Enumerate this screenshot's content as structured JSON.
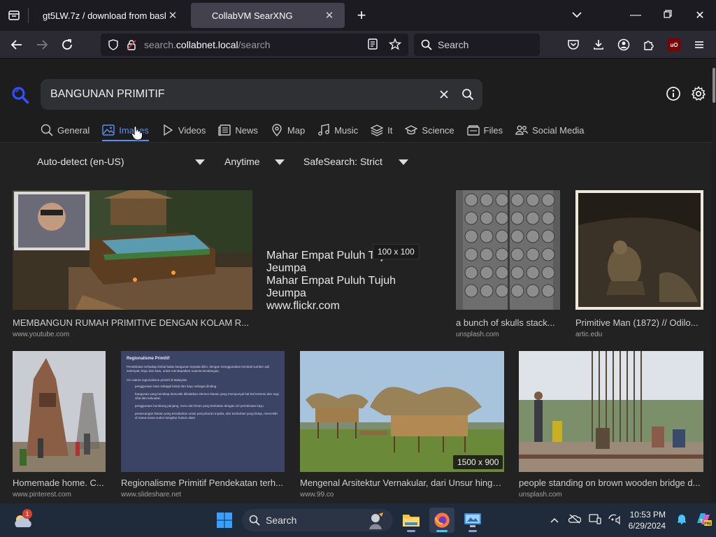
{
  "browser": {
    "tabs": [
      {
        "title": "gt5LW.7z / download from bashupl",
        "active": false
      },
      {
        "title": "CollabVM SearXNG",
        "active": true
      }
    ],
    "url": {
      "prefix": "search.",
      "host": "collabnet.local",
      "path": "/search"
    },
    "search_placeholder": "Search"
  },
  "search": {
    "query": "BANGUNAN PRIMITIF",
    "categories": [
      {
        "label": "General",
        "icon": "search-icon"
      },
      {
        "label": "Images",
        "icon": "image-icon",
        "active": true
      },
      {
        "label": "Videos",
        "icon": "play-icon"
      },
      {
        "label": "News",
        "icon": "newspaper-icon"
      },
      {
        "label": "Map",
        "icon": "map-pin-icon"
      },
      {
        "label": "Music",
        "icon": "music-icon"
      },
      {
        "label": "It",
        "icon": "layers-icon"
      },
      {
        "label": "Science",
        "icon": "graduation-cap-icon"
      },
      {
        "label": "Files",
        "icon": "files-icon"
      },
      {
        "label": "Social Media",
        "icon": "users-icon"
      }
    ],
    "filters": {
      "language": "Auto-detect (en-US)",
      "time": "Anytime",
      "safesearch": "SafeSearch: Strict"
    }
  },
  "results": [
    {
      "title": "MEMBANGUN RUMAH PRIMITIVE DENGAN KOLAM R...",
      "source": "www.youtube.com"
    },
    {
      "title": "a bunch of skulls stack...",
      "source": "unsplash.com"
    },
    {
      "title": "Primitive Man (1872) // Odilo...",
      "source": "artic.edu"
    },
    {
      "title": "Homemade home. C...",
      "source": "www.pinterest.com"
    },
    {
      "title": "Regionalisme Primitif Pendekatan terh...",
      "source": "www.slideshare.net"
    },
    {
      "title": "Mengenal Arsitektur Vernakular, dari Unsur hingg...",
      "source": "www.99.co"
    },
    {
      "title": "people standing on brown wooden bridge d...",
      "source": "unsplash.com"
    }
  ],
  "detail": {
    "link": "Mahar Empat Puluh Tujuh Jeumpa",
    "subtitle": "Mahar Empat Puluh Tujuh Jeumpa",
    "source": "www.flickr.com",
    "dimension": "100 x 100"
  },
  "badges": {
    "mengenal_dimension": "1500 x 900"
  },
  "slide": {
    "heading": "Regionalisme Primitif",
    "intro": "Pendekatan terhadap timbal balas bangunan kepada iklim, dengan menggunakan kembali sumber asli setempat; kayu dan batu, untuk mendapatkan nuansa kenalangan.",
    "list_title": "Ciri utama regionalisme primitif di Malaysia:",
    "items": [
      "penggunaan batu sebagai lantai dan kayu sebagai dinding",
      "bangunan yang bersikap domestik diletakkan elemen biasan yang mempunyai hal-hal tertentu dan segi sifat dan kekuatan",
      "penggunaan bumbung panjang, meru dari limas yang berkaitan dengan ciri pembinaan kayu",
      "perancangan biasan yang tersalurkan untuk penyuburan tropika, dan tumbuhan yang hidup, mencelah di mana-mana sudut mengikut hukum alam"
    ]
  },
  "taskbar": {
    "search_label": "Search",
    "time": "10:53 PM",
    "date": "6/29/2024",
    "weather_badge": "1"
  },
  "colors": {
    "accent": "#5d8ff0",
    "link": "#7ea6f5",
    "page_bg": "#222222"
  }
}
